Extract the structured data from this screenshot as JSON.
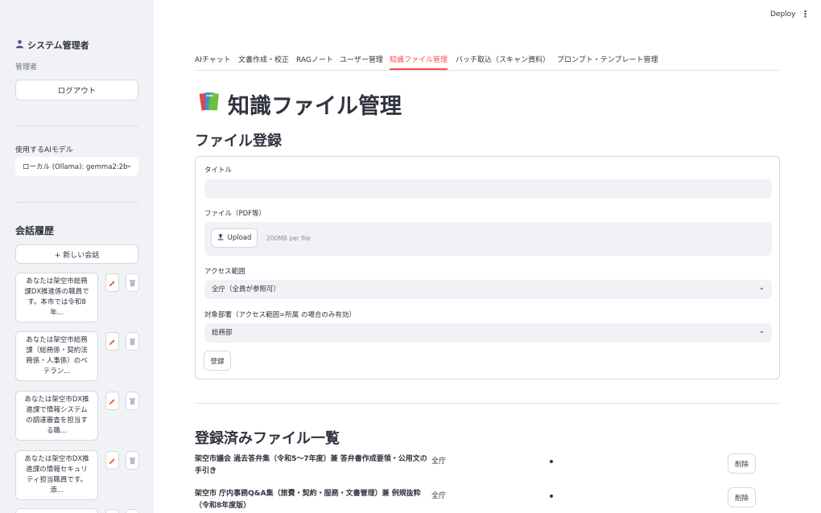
{
  "sidebar": {
    "user_name": "システム管理者",
    "role": "管理者",
    "logout_label": "ログアウト",
    "model_label": "使用するAIモデル",
    "model_value": "ローカル (Ollama): gemma2:2b",
    "history_title": "会話履歴",
    "new_chat_label": "+ 新しい会話",
    "history": [
      "あなたは架空市総務\n課DX推進係の職員で\nす。本市では令和8\n年...",
      "あなたは架空市総務\n課（総務係・契約法\n務係・人事係）のベ\nテラン...",
      "あなたは架空市DX推\n進課で情報システム\nの調達審査を担当す\nる職...",
      "あなたは架空市DX推\n進課の情報セキュリ\nティ担当職員です。\n添..."
    ]
  },
  "header": {
    "deploy_label": "Deploy"
  },
  "tabs": [
    {
      "label": "AIチャット"
    },
    {
      "label": "文書作成・校正"
    },
    {
      "label": "RAGノート"
    },
    {
      "label": "ユーザー管理"
    },
    {
      "label": "知識ファイル管理"
    },
    {
      "label": "バッチ取込（スキャン資料）"
    },
    {
      "label": "プロンプト・テンプレート管理"
    }
  ],
  "page": {
    "title": "知識ファイル管理",
    "section_register": "ファイル登録",
    "section_list": "登録済みファイル一覧"
  },
  "form": {
    "title_label": "タイトル",
    "title_value": "",
    "file_label": "ファイル（PDF等）",
    "upload_label": "Upload",
    "upload_hint": "200MB per file",
    "access_label": "アクセス範囲",
    "access_value": "全庁（全員が参照可）",
    "dept_label": "対象部署（アクセス範囲=所属 の場合のみ有効）",
    "dept_value": "総務部",
    "submit_label": "登録"
  },
  "files": [
    {
      "name": "架空市議会 過去答弁集（令和5〜7年度）兼 答弁書作成要領・公用文の手引き",
      "scope": "全庁",
      "delete_label": "削除"
    },
    {
      "name": "架空市 庁内事務Q&A集（旅費・契約・服務・文書管理）兼 例規抜粋（令和8年度版）",
      "scope": "全庁",
      "delete_label": "削除"
    }
  ],
  "colors": {
    "accent": "#ff4b4b",
    "sidebar_bg": "#f0f2f6",
    "text": "#31333f"
  }
}
